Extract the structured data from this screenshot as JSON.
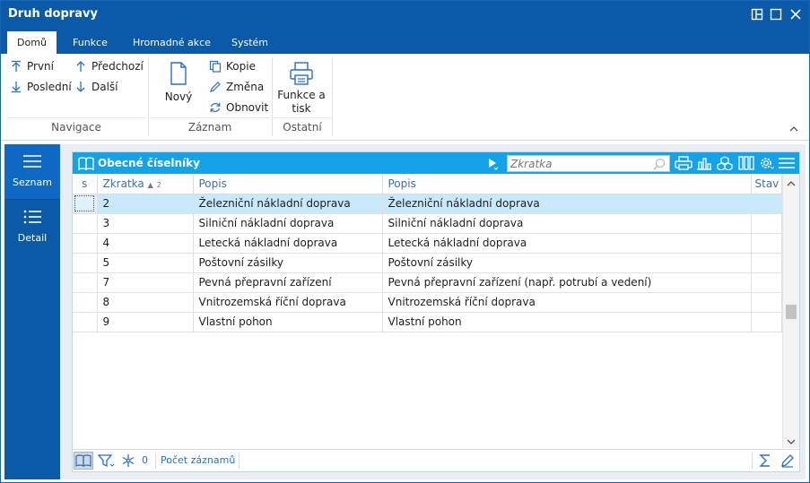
{
  "window": {
    "title": "Druh dopravy"
  },
  "tabs": [
    {
      "label": "Domů",
      "active": true
    },
    {
      "label": "Funkce"
    },
    {
      "label": "Hromadné akce"
    },
    {
      "label": "Systém"
    }
  ],
  "ribbon": {
    "navigace": {
      "first": "První",
      "prev": "Předchozí",
      "last": "Poslední",
      "next": "Další",
      "group": "Navigace"
    },
    "zaznam": {
      "new": "Nový",
      "copy": "Kopie",
      "change": "Změna",
      "refresh": "Obnovit",
      "group": "Záznam"
    },
    "ostatni": {
      "print_line1": "Funkce a",
      "print_line2": "tisk",
      "group": "Ostatní"
    }
  },
  "leftnav": [
    {
      "label": "Seznam",
      "icon": "menu-icon",
      "active": true
    },
    {
      "label": "Detail",
      "icon": "list-icon"
    }
  ],
  "panel": {
    "title": "Obecné číselníky",
    "search_placeholder": "Zkratka"
  },
  "table": {
    "columns": {
      "s": "s",
      "zkratka": "Zkratka",
      "sort_order": "2",
      "popis1": "Popis",
      "popis2": "Popis",
      "stav": "Stav"
    },
    "rows": [
      {
        "zkratka": "2",
        "popis1": "Železniční nákladní doprava",
        "popis2": "Železniční nákladní doprava",
        "stav": ""
      },
      {
        "zkratka": "3",
        "popis1": "Silniční nákladní doprava",
        "popis2": "Silniční nákladní doprava",
        "stav": ""
      },
      {
        "zkratka": "4",
        "popis1": "Letecká nákladní doprava",
        "popis2": "Letecká nákladní doprava",
        "stav": ""
      },
      {
        "zkratka": "5",
        "popis1": "Poštovní zásilky",
        "popis2": "Poštovní zásilky",
        "stav": ""
      },
      {
        "zkratka": "7",
        "popis1": "Pevná přepravní zařízení",
        "popis2": "Pevná přepravní zařízení (např. potrubí a vedení)",
        "stav": ""
      },
      {
        "zkratka": "8",
        "popis1": "Vnitrozemská říční doprava",
        "popis2": "Vnitrozemská říční doprava",
        "stav": ""
      },
      {
        "zkratka": "9",
        "popis1": "Vlastní pohon",
        "popis2": "Vlastní pohon",
        "stav": ""
      }
    ]
  },
  "statusbar": {
    "filter_count": "0",
    "record_count_label": "Počet záznamů"
  },
  "colors": {
    "titlebar": "#0b5aa8",
    "panel_header": "#14a3e6",
    "selected_row": "#c8e9fa",
    "column_header_text": "#3f6fa8"
  }
}
